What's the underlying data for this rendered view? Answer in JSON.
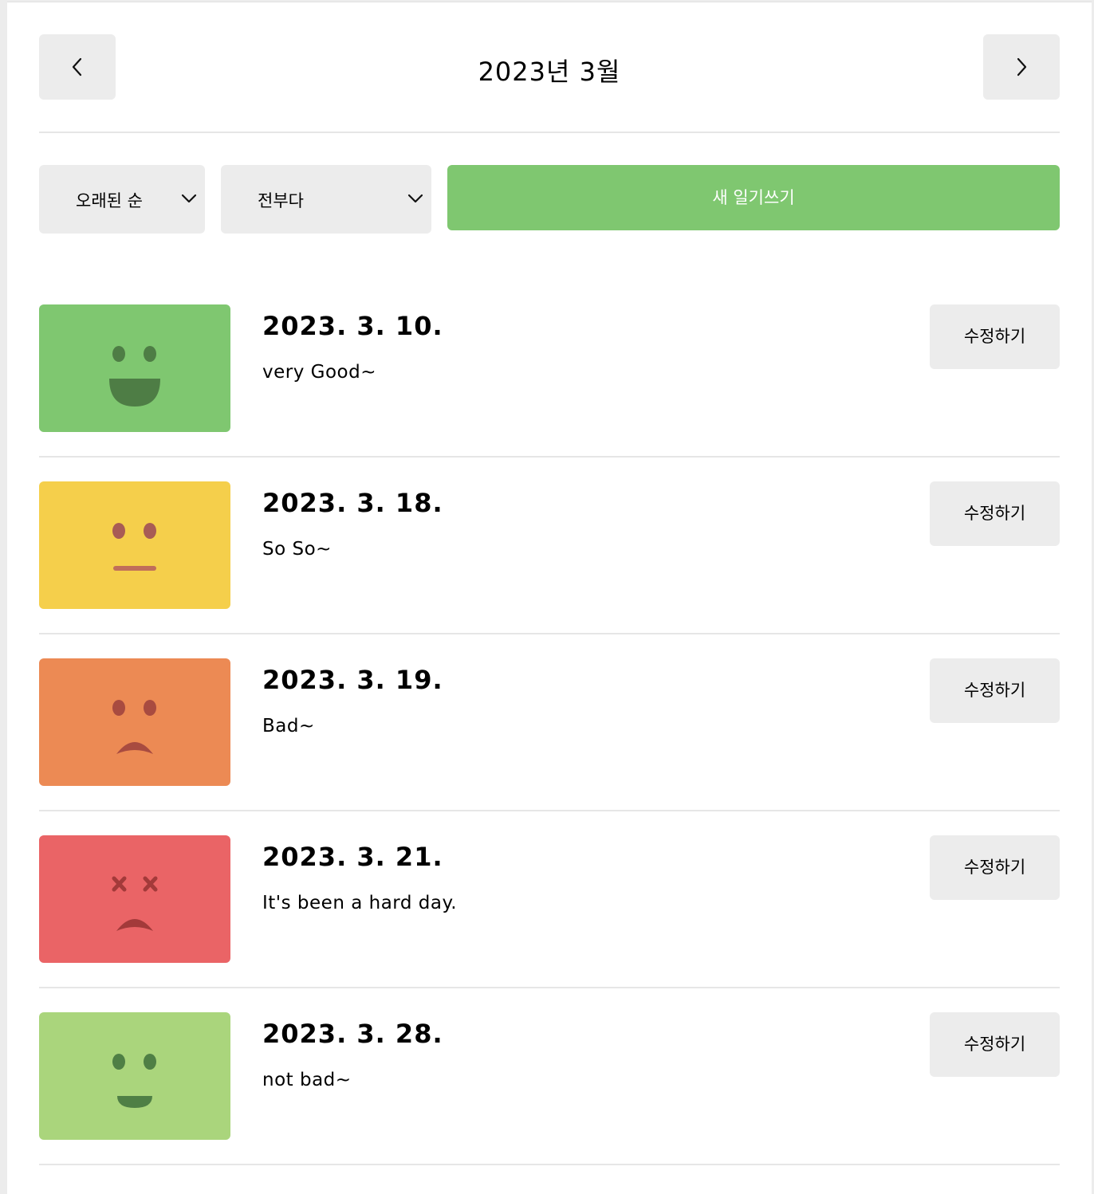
{
  "header": {
    "title": "2023년 3월",
    "prev_icon": "chevron-left-icon",
    "next_icon": "chevron-right-icon"
  },
  "toolbar": {
    "sort_select": {
      "value": "오래된 순",
      "icon": "chevron-down-icon"
    },
    "filter_select": {
      "value": "전부다",
      "icon": "chevron-down-icon"
    },
    "new_button_label": "새 일기쓰기",
    "accent_color": "#7fc770"
  },
  "diary_list": [
    {
      "date": "2023. 3. 10.",
      "content": "very Good~",
      "edit_label": "수정하기",
      "emotion": "very-good-face-icon",
      "color": "#7fc770"
    },
    {
      "date": "2023. 3. 18.",
      "content": "So So~",
      "edit_label": "수정하기",
      "emotion": "so-so-face-icon",
      "color": "#f5cf4b"
    },
    {
      "date": "2023. 3. 19.",
      "content": "Bad~",
      "edit_label": "수정하기",
      "emotion": "bad-face-icon",
      "color": "#ec8a54"
    },
    {
      "date": "2023. 3. 21.",
      "content": "It's been a hard day.",
      "edit_label": "수정하기",
      "emotion": "terrible-face-icon",
      "color": "#ea6466"
    },
    {
      "date": "2023. 3. 28.",
      "content": "not bad~",
      "edit_label": "수정하기",
      "emotion": "good-face-icon",
      "color": "#aad57c"
    }
  ]
}
